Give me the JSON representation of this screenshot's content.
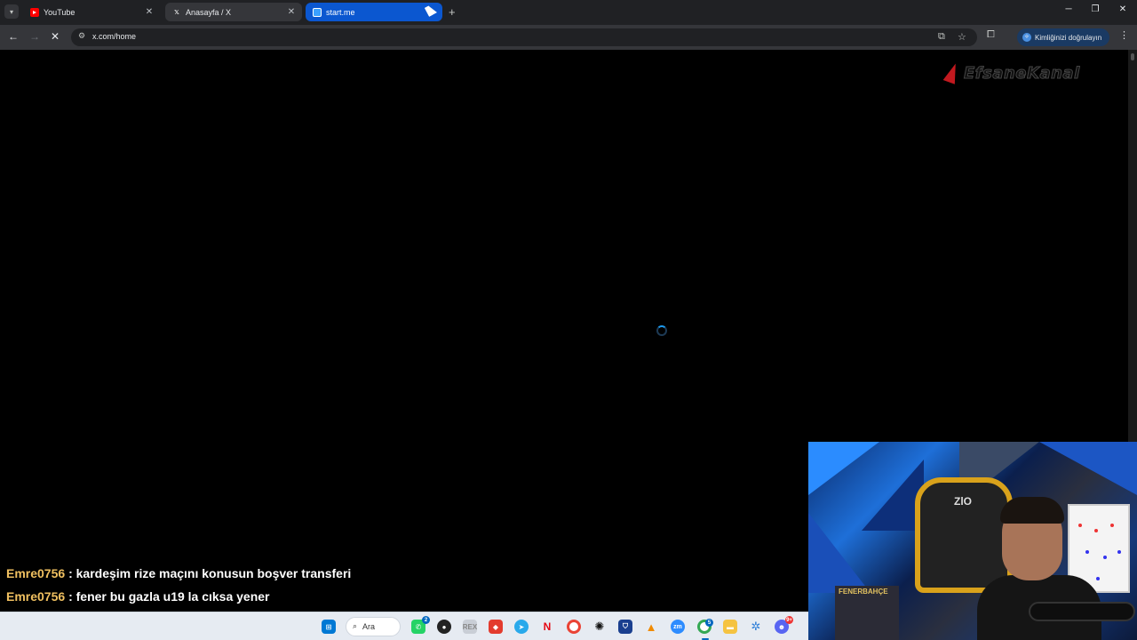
{
  "tabs": [
    {
      "title": "YouTube",
      "icon": "youtube-icon"
    },
    {
      "title": "Anasayfa / X",
      "icon": "x-icon"
    },
    {
      "title": "start.me",
      "icon": "startme-icon"
    }
  ],
  "toolbar": {
    "url": "x.com/home",
    "verify_label": "Kimliğinizi doğrulayın"
  },
  "overlay": {
    "brand_text": "EfsaneKanal"
  },
  "chat": [
    {
      "user": "Emre0756",
      "message": "kardeşim rize maçını konusun boşver transferi"
    },
    {
      "user": "Emre0756",
      "message": "fener bu gazla u19 la cıksa yener"
    }
  ],
  "webcam": {
    "chair_text": "ZlO",
    "poster_text": "FENERBAHÇE"
  },
  "taskbar": {
    "search_label": "Ara",
    "whatsapp_badge": "2",
    "discord_badge": "9+",
    "chrome_badge": "5"
  },
  "colors": {
    "tab_strip": "#202124",
    "toolbar": "#35363a",
    "active_tab": "#0b57d0",
    "chat_user": "#f0c060",
    "taskbar": "#e6ebf2"
  }
}
